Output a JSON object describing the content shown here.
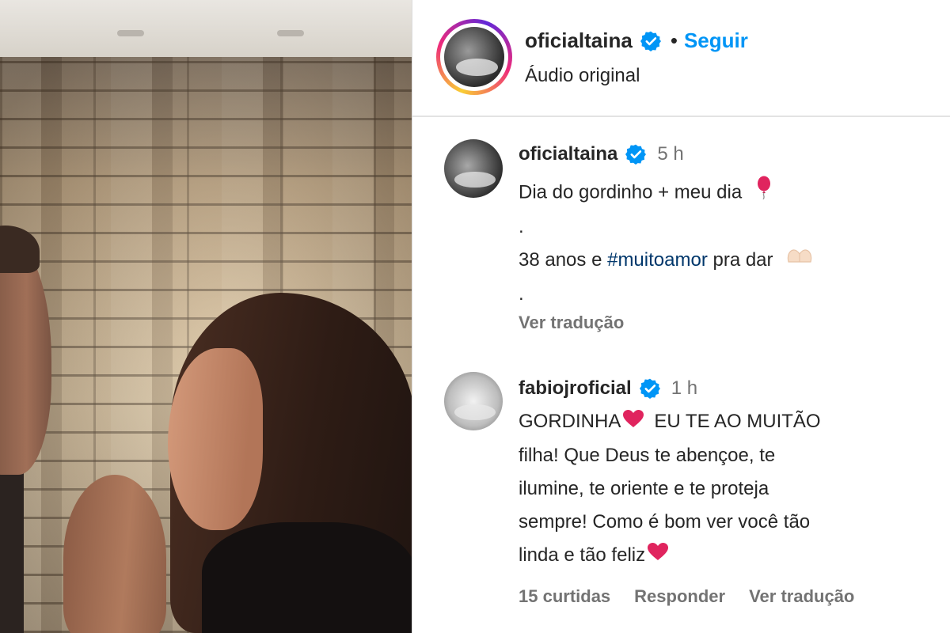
{
  "post_header": {
    "username": "oficialtaina",
    "separator": "•",
    "follow_label": "Seguir",
    "audio_label": "Áudio original"
  },
  "caption": {
    "username": "oficialtaina",
    "time": "5 h",
    "line1": "Dia do gordinho + meu dia",
    "dot1": ".",
    "line2_prefix": "38 anos e ",
    "hashtag": "#muitoamor",
    "line2_suffix": " pra dar",
    "dot2": ".",
    "translate_label": "Ver tradução",
    "icons": [
      "balloon-icon",
      "heart-hands-icon"
    ]
  },
  "reply": {
    "username": "fabiojroficial",
    "time": "1 h",
    "line1_a": "GORDINHA",
    "line1_b": "EU TE AO MUITÃO",
    "line2": "filha! Que Deus te abençoe, te",
    "line3": "ilumine, te oriente e te proteja",
    "line4": "sempre! Como é bom ver você tão",
    "line5": "linda e tão feliz",
    "likes_label": "15 curtidas",
    "reply_label": "Responder",
    "translate_label": "Ver tradução",
    "icons": [
      "red-heart-icon"
    ]
  },
  "colors": {
    "accent_blue": "#0095f6",
    "verified_blue": "#0095f6",
    "hashtag": "#00376b",
    "secondary_text": "#737373",
    "heart_red": "#e0245e"
  }
}
